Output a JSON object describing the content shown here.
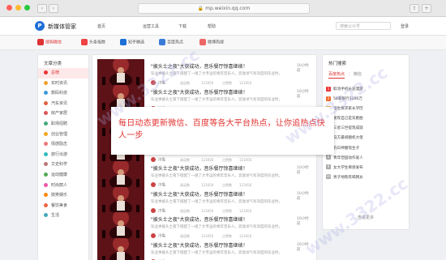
{
  "window": {
    "url": "mp.weixin.qq.com"
  },
  "nav": {
    "logo_letter": "P",
    "logo_text": "新媒体管家",
    "links": [
      "首页",
      "运营工具",
      "下载",
      "帮助"
    ],
    "search_placeholder": "搜索公众号",
    "login_label": "登录"
  },
  "subnav": {
    "tabs": [
      {
        "label": "搜狗微信",
        "color": "#d33"
      },
      {
        "label": "头条指数",
        "color": "#e44"
      },
      {
        "label": "知乎精选",
        "color": "#1e6fd6"
      },
      {
        "label": "百度热点",
        "color": "#3a7bd5"
      },
      {
        "label": "微博热搜",
        "color": "#e66"
      }
    ]
  },
  "sidebar": {
    "title": "文章分类",
    "items": [
      {
        "label": "总榜",
        "color": "#e33"
      },
      {
        "label": "实时资讯",
        "color": "#f0a030"
      },
      {
        "label": "数码科技",
        "color": "#3a9ad9"
      },
      {
        "label": "汽车资讯",
        "color": "#e06040"
      },
      {
        "label": "房产家居",
        "color": "#d55"
      },
      {
        "label": "职场招聘",
        "color": "#4a7"
      },
      {
        "label": "创业管理",
        "color": "#f5a623"
      },
      {
        "label": "情感励志",
        "color": "#e77"
      },
      {
        "label": "旅行出游",
        "color": "#3bb"
      },
      {
        "label": "文史科学",
        "color": "#b77"
      },
      {
        "label": "运动健康",
        "color": "#5a5"
      },
      {
        "label": "时尚丽人",
        "color": "#e5a"
      },
      {
        "label": "搞笑娱乐",
        "color": "#f80"
      },
      {
        "label": "餐饮美食",
        "color": "#e64"
      },
      {
        "label": "生活",
        "color": "#4ab"
      }
    ]
  },
  "articles": {
    "title": "\"披头士之夜\"大获成功，音乐餐厅惊喜继续！",
    "desc": "毕业季披头士夜下搭配了一组了大专运的青年音乐人，奔放洋气有深度的毕业时，",
    "author": "冷兔",
    "stats": [
      "阅读数",
      "123456",
      "点赞数",
      "123456"
    ],
    "time": "10小时前",
    "count": 8
  },
  "hot": {
    "title": "热门搜索",
    "tabs": [
      "百度热点",
      "微信"
    ],
    "items": [
      {
        "rank": "1",
        "text": "取消手机长途漫游",
        "color": "#e33"
      },
      {
        "rank": "2",
        "text": "58家银行3200万",
        "color": "#f06a2a"
      },
      {
        "rank": "3",
        "text": "招生要求家长学历",
        "color": "#f5a623"
      },
      {
        "rank": "4",
        "text": "发现自己是双胞胎",
        "color": "#aaa"
      },
      {
        "rank": "5",
        "text": "三星三世提现成就",
        "color": "#aaa"
      },
      {
        "rank": "6",
        "text": "马方最闹翻机大佬",
        "color": "#aaa"
      },
      {
        "rank": "7",
        "text": "钓日神圈现生子",
        "color": "#aaa"
      },
      {
        "rank": "8",
        "text": "青年塑园动作爱人",
        "color": "#aaa"
      },
      {
        "rank": "9",
        "text": "女大学生佛感发布",
        "color": "#aaa"
      },
      {
        "rank": "10",
        "text": "男子地铁有喝网女",
        "color": "#aaa"
      }
    ],
    "more": "查看更多"
  },
  "overlay": {
    "text": "每日动态更新微信、百度等各大平台热点，让你追热点快人一步"
  },
  "watermark": "www.3322.cc"
}
